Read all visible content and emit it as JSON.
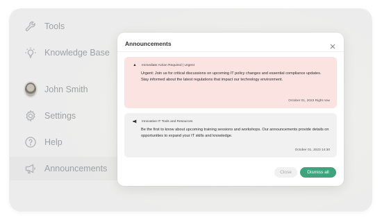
{
  "sidebar": {
    "items": [
      {
        "label": "Tools",
        "icon": "wrench-icon"
      },
      {
        "label": "Knowledge Base",
        "icon": "lightbulb-icon"
      },
      {
        "label": "John Smith",
        "icon": "avatar"
      },
      {
        "label": "Settings",
        "icon": "gear-icon"
      },
      {
        "label": "Help",
        "icon": "help-circle-icon"
      },
      {
        "label": "Announcements",
        "icon": "megaphone-icon",
        "active": true
      }
    ]
  },
  "modal": {
    "title": "Announcements",
    "close_icon": "close-icon",
    "announcements": [
      {
        "header": "Immediate Action Required | Urgent",
        "icon": "warning-icon",
        "body": "Urgent: Join us for critical discussions on upcoming IT policy changes and essential compliance updates. Stay informed about the latest regulations that impact our technology environment.",
        "time": "October 01, 2023 Right now",
        "background": "#fbe3e1"
      },
      {
        "header": "Innovative IT Tools and Resources",
        "icon": "megaphone-icon",
        "body": "Be the first to know about upcoming training sessions and workshops. Our announcements provide details on opportunities to expand your IT skills and knowledge.",
        "time": "October 01, 2023 14:30",
        "background": "#f1f1f1"
      }
    ],
    "buttons": {
      "close_label": "Close",
      "dismiss_label": "Dismiss all"
    }
  },
  "colors": {
    "accent": "#3fa37e",
    "urgent_bg": "#fbe3e1",
    "info_bg": "#f1f1f1"
  }
}
